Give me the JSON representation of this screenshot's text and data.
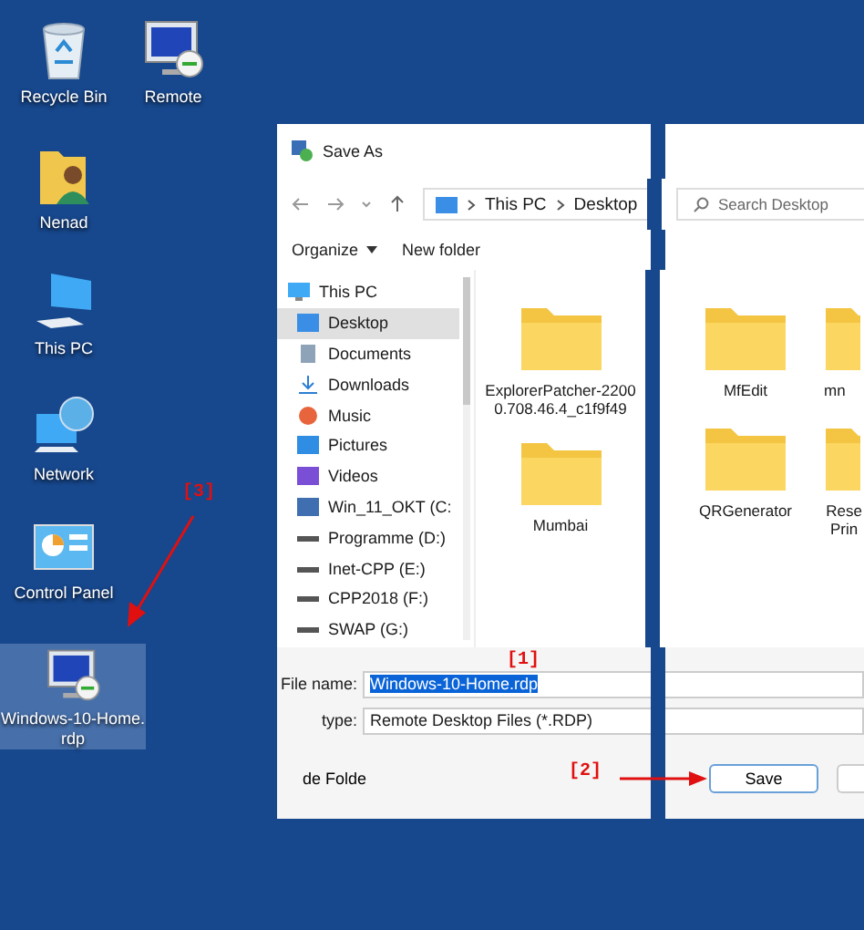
{
  "desktop_icons": [
    {
      "label": "Recycle Bin",
      "kind": "recycle",
      "selected": false
    },
    {
      "label": "Remote",
      "kind": "remote",
      "selected": false
    },
    {
      "label": "Nenad",
      "kind": "user",
      "selected": false
    },
    {
      "label": "This PC",
      "kind": "pc",
      "selected": false
    },
    {
      "label": "Network",
      "kind": "network",
      "selected": false
    },
    {
      "label": "Control Panel",
      "kind": "control",
      "selected": false
    },
    {
      "label": "Windows-10-Home.rdp",
      "kind": "remote",
      "selected": true
    }
  ],
  "dialog": {
    "title": "Save As",
    "address": [
      "This PC",
      "Desktop"
    ],
    "search": {
      "placeholder": "Search Desktop"
    },
    "toolbar": {
      "organize": "Organize",
      "new_folder": "New folder"
    },
    "nav": [
      {
        "label": "This PC",
        "kind": "pc",
        "selected": false,
        "children": [
          {
            "label": "Desktop",
            "kind": "desktop",
            "selected": true
          },
          {
            "label": "Documents",
            "kind": "documents",
            "selected": false
          },
          {
            "label": "Downloads",
            "kind": "downloads",
            "selected": false
          },
          {
            "label": "Music",
            "kind": "music",
            "selected": false
          },
          {
            "label": "Pictures",
            "kind": "pictures",
            "selected": false
          },
          {
            "label": "Videos",
            "kind": "videos",
            "selected": false
          },
          {
            "label": "Win_11_OKT (C:",
            "kind": "system_drive",
            "selected": false
          },
          {
            "label": "Programme (D:)",
            "kind": "drive",
            "selected": false
          },
          {
            "label": "Inet-CPP (E:)",
            "kind": "drive",
            "selected": false
          },
          {
            "label": "CPP2018 (F:)",
            "kind": "drive",
            "selected": false
          },
          {
            "label": "SWAP (G:)",
            "kind": "drive",
            "selected": false
          }
        ]
      }
    ],
    "folders_left": [
      "ExplorerPatcher-22000.708.46.4_c1f9f49",
      "Mumbai"
    ],
    "folders_right": [
      "MfEdit",
      "mn",
      "QRGenerator",
      "Rese Prin"
    ],
    "file_name": {
      "label": "File name:",
      "value": "Windows-10-Home.rdp",
      "selected": true
    },
    "file_type": {
      "label": "type:",
      "value": "Remote Desktop Files (*.RDP)"
    },
    "hide_folders": "de Folde",
    "save_button": "Save"
  },
  "annotations": [
    "[1]",
    "[2]",
    "[3]"
  ]
}
